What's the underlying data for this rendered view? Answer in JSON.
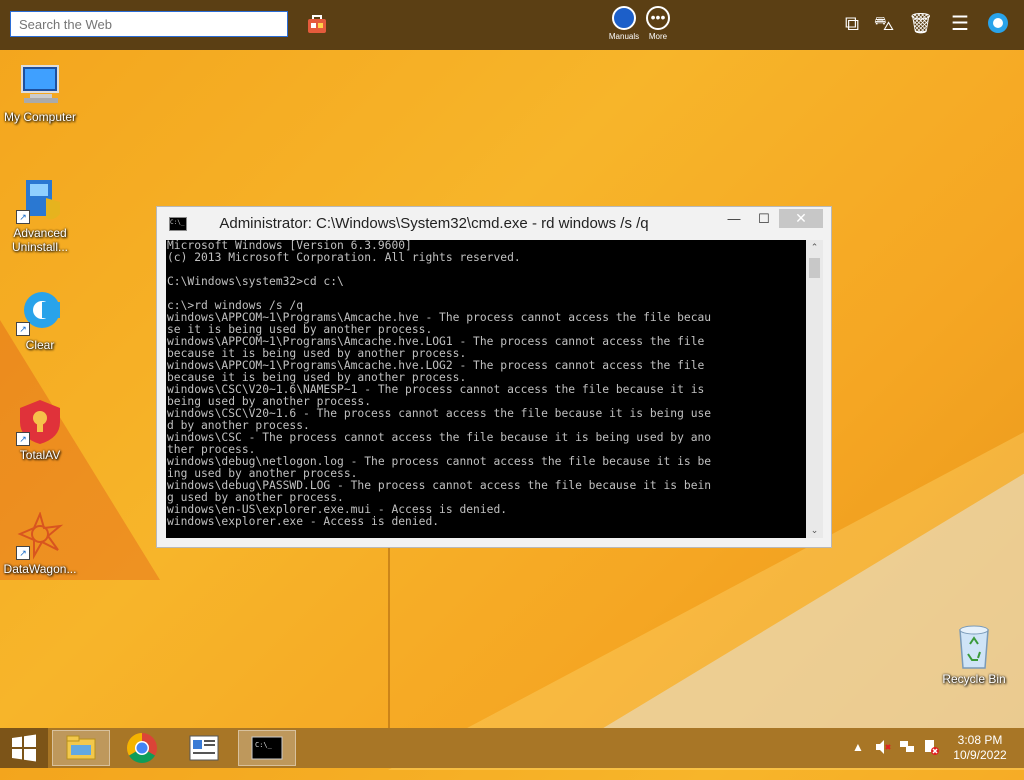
{
  "topbar": {
    "search_placeholder": "Search the Web",
    "manuals_label": "Manuals",
    "more_label": "More"
  },
  "desktop_icons": [
    {
      "label": "My Computer",
      "icon": "computer-icon"
    },
    {
      "label": "Advanced Uninstall...",
      "icon": "installer-icon"
    },
    {
      "label": "Clear",
      "icon": "clear-icon"
    },
    {
      "label": "TotalAV",
      "icon": "shield-icon"
    },
    {
      "label": "DataWagon...",
      "icon": "star-icon"
    }
  ],
  "recycle_bin": {
    "label": "Recycle Bin"
  },
  "window": {
    "title": "Administrator: C:\\Windows\\System32\\cmd.exe - rd  windows /s /q",
    "console_lines": [
      "Microsoft Windows [Version 6.3.9600]",
      "(c) 2013 Microsoft Corporation. All rights reserved.",
      "",
      "C:\\Windows\\system32>cd c:\\",
      "",
      "c:\\>rd windows /s /q",
      "windows\\APPCOM~1\\Programs\\Amcache.hve - The process cannot access the file becau",
      "se it is being used by another process.",
      "windows\\APPCOM~1\\Programs\\Amcache.hve.LOG1 - The process cannot access the file",
      "because it is being used by another process.",
      "windows\\APPCOM~1\\Programs\\Amcache.hve.LOG2 - The process cannot access the file",
      "because it is being used by another process.",
      "windows\\CSC\\V20~1.6\\NAMESP~1 - The process cannot access the file because it is",
      "being used by another process.",
      "windows\\CSC\\V20~1.6 - The process cannot access the file because it is being use",
      "d by another process.",
      "windows\\CSC - The process cannot access the file because it is being used by ano",
      "ther process.",
      "windows\\debug\\netlogon.log - The process cannot access the file because it is be",
      "ing used by another process.",
      "windows\\debug\\PASSWD.LOG - The process cannot access the file because it is bein",
      "g used by another process.",
      "windows\\en-US\\explorer.exe.mui - Access is denied.",
      "windows\\explorer.exe - Access is denied."
    ]
  },
  "taskbar": {
    "apps": [
      "file-explorer-icon",
      "chrome-icon",
      "document-viewer-icon",
      "cmd-icon"
    ],
    "time": "3:08 PM",
    "date": "10/9/2022"
  },
  "colors": {
    "desktop": "#f5a623",
    "topbar": "#5b3f14",
    "taskbar": "#a87626"
  }
}
